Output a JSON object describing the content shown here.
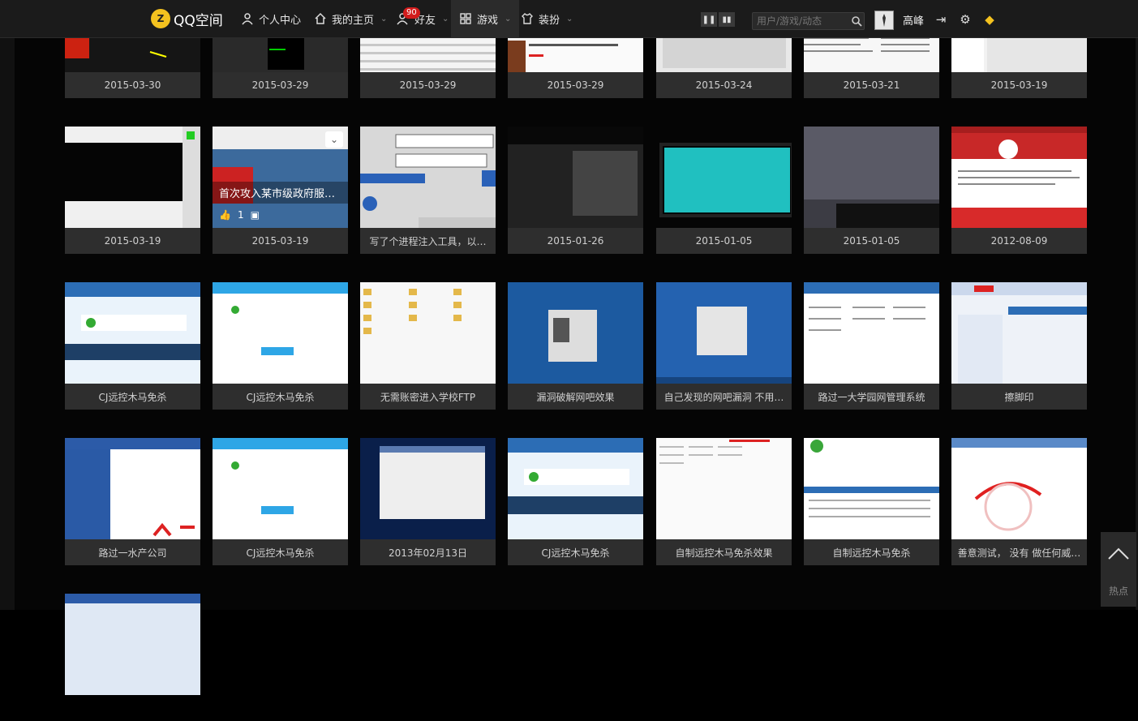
{
  "topbar": {
    "logo_text": "QQ空间",
    "logo_badge": "Z",
    "nav": [
      {
        "label": "个人中心",
        "icon": "person-icon"
      },
      {
        "label": "我的主页",
        "icon": "home-icon"
      },
      {
        "label": "好友",
        "icon": "friends-icon",
        "badge": "90"
      },
      {
        "label": "游戏",
        "icon": "grid-icon"
      },
      {
        "label": "装扮",
        "icon": "shirt-icon"
      }
    ],
    "search_placeholder": "用户/游戏/动态",
    "username": "高峰"
  },
  "albums": [
    {
      "caption": "2015-03-30"
    },
    {
      "caption": "2015-03-29"
    },
    {
      "caption": "2015-03-29"
    },
    {
      "caption": "2015-03-29"
    },
    {
      "caption": "2015-03-24"
    },
    {
      "caption": "2015-03-21"
    },
    {
      "caption": "2015-03-19"
    },
    {
      "caption": "2015-03-19"
    },
    {
      "caption": "2015-03-19",
      "overlay_title": "首次攻入某市级政府服…",
      "likes": "1"
    },
    {
      "caption": "写了个进程注入工具，以…"
    },
    {
      "caption": "2015-01-26"
    },
    {
      "caption": "2015-01-05"
    },
    {
      "caption": "2015-01-05"
    },
    {
      "caption": "2012-08-09"
    },
    {
      "caption": "CJ远控木马免杀"
    },
    {
      "caption": "CJ远控木马免杀"
    },
    {
      "caption": "无需账密进入学校FTP"
    },
    {
      "caption": "漏洞破解网吧效果"
    },
    {
      "caption": "自己发现的网吧漏洞 不用…"
    },
    {
      "caption": "路过一大学园网管理系统"
    },
    {
      "caption": "擦脚印"
    },
    {
      "caption": "路过一水产公司"
    },
    {
      "caption": "CJ远控木马免杀"
    },
    {
      "caption": "2013年02月13日"
    },
    {
      "caption": "CJ远控木马免杀"
    },
    {
      "caption": "自制远控木马免杀效果"
    },
    {
      "caption": "自制远控木马免杀"
    },
    {
      "caption": "善意测试， 没有 做任何威…"
    }
  ],
  "scroll_top_label": "热点",
  "colors": {
    "topbar_bg": "#1b1b1b",
    "caption_bg": "#2e2e2e",
    "badge_red": "#d21b1b",
    "vip_gold": "#f4c21f"
  }
}
